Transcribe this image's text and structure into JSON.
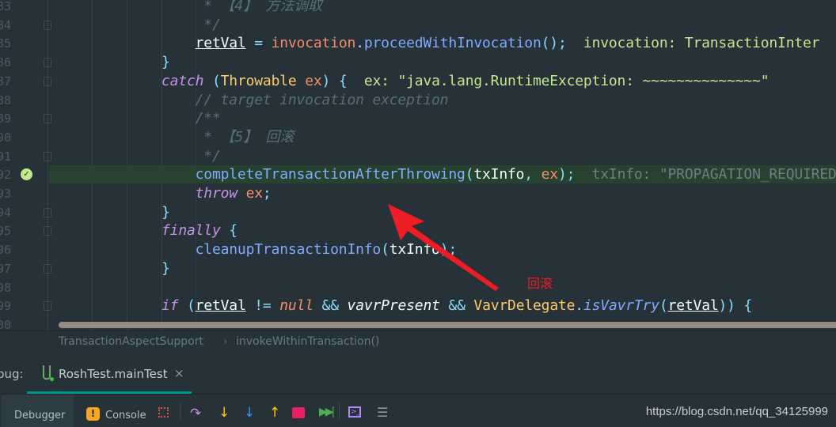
{
  "editor": {
    "line_numbers": [
      "83",
      "84",
      "85",
      "86",
      "87",
      "88",
      "89",
      "90",
      "91",
      "92",
      "93",
      "94",
      "95",
      "96",
      "97",
      "98",
      "99",
      "00"
    ],
    "current_line_index": 9,
    "lines": [
      [
        [
          "     * 【4】 方法调取",
          "cm"
        ]
      ],
      [
        [
          "     */",
          "cm"
        ]
      ],
      [
        [
          "    ",
          "plain"
        ],
        [
          "retVal",
          "var"
        ],
        [
          " = ",
          "op"
        ],
        [
          "invocation",
          "fld"
        ],
        [
          ".",
          "pun"
        ],
        [
          "proceedWithInvocation",
          "fn"
        ],
        [
          "();",
          "pun"
        ],
        [
          "  invocation: TransactionInter",
          "hint"
        ]
      ],
      [
        [
          "}",
          "pun"
        ]
      ],
      [
        [
          "catch",
          "kw"
        ],
        [
          " (",
          "pun"
        ],
        [
          "Throwable",
          "type"
        ],
        [
          " ex",
          "fld"
        ],
        [
          ") {",
          "pun"
        ],
        [
          "  ex: \"java.lang.RuntimeException: ~~~~~~~~~~~~~~\"",
          "hint"
        ]
      ],
      [
        [
          "    // target invocation exception",
          "cm"
        ]
      ],
      [
        [
          "    /**",
          "cm"
        ]
      ],
      [
        [
          "     * 【5】 回滚",
          "cm"
        ]
      ],
      [
        [
          "     */",
          "cm"
        ]
      ],
      [
        [
          "    ",
          "plain"
        ],
        [
          "completeTransactionAfterThrowing",
          "fn"
        ],
        [
          "(",
          "pun"
        ],
        [
          "txInfo",
          "plain"
        ],
        [
          ", ",
          "pun"
        ],
        [
          "ex",
          "fld"
        ],
        [
          ");",
          "pun"
        ],
        [
          "  txInfo: \"PROPAGATION_REQUIRED",
          "hintg"
        ]
      ],
      [
        [
          "    ",
          "plain"
        ],
        [
          "throw",
          "kw"
        ],
        [
          " ex",
          "fld"
        ],
        [
          ";",
          "pun"
        ]
      ],
      [
        [
          "}",
          "pun"
        ]
      ],
      [
        [
          "finally",
          "kw"
        ],
        [
          " {",
          "pun"
        ]
      ],
      [
        [
          "    ",
          "plain"
        ],
        [
          "cleanupTransactionInfo",
          "fn"
        ],
        [
          "(",
          "pun"
        ],
        [
          "txInfo",
          "plain"
        ],
        [
          ");",
          "pun"
        ]
      ],
      [
        [
          "}",
          "pun"
        ]
      ],
      [
        [
          "",
          "plain"
        ]
      ],
      [
        [
          "if",
          "kw"
        ],
        [
          " (",
          "pun"
        ],
        [
          "retVal",
          "var"
        ],
        [
          " != ",
          "op"
        ],
        [
          "null",
          "null"
        ],
        [
          " && ",
          "op"
        ],
        [
          "vavrPresent",
          "itv"
        ],
        [
          " && ",
          "op"
        ],
        [
          "VavrDelegate",
          "type"
        ],
        [
          ".",
          "pun"
        ],
        [
          "isVavrTry",
          "fni"
        ],
        [
          "(",
          "pun"
        ],
        [
          "retVal",
          "var"
        ],
        [
          ")) {",
          "pun"
        ]
      ],
      [
        [
          "",
          "plain"
        ]
      ]
    ]
  },
  "annotation": {
    "label": "回滚",
    "color": "#ee1c24"
  },
  "breadcrumb": {
    "items": [
      "TransactionAspectSupport",
      "invokeWithinTransaction()"
    ],
    "separator": "›"
  },
  "debug_panel": {
    "label": "bug:",
    "tab": {
      "label": "RoshTest.mainTest",
      "close": "×",
      "icon": "test-tube-icon"
    },
    "accent": "#009688"
  },
  "toolbar": {
    "debugger_tab": "Debugger",
    "console_tab": "Console",
    "icons": [
      "restore-layout-icon",
      "step-over-icon",
      "step-into-icon",
      "force-step-into-icon",
      "step-out-icon",
      "drop-frame-icon",
      "run-to-cursor-icon",
      "evaluate-expression-icon",
      "trace-icon"
    ]
  },
  "watermark": "https://blog.csdn.net/qq_34125999"
}
